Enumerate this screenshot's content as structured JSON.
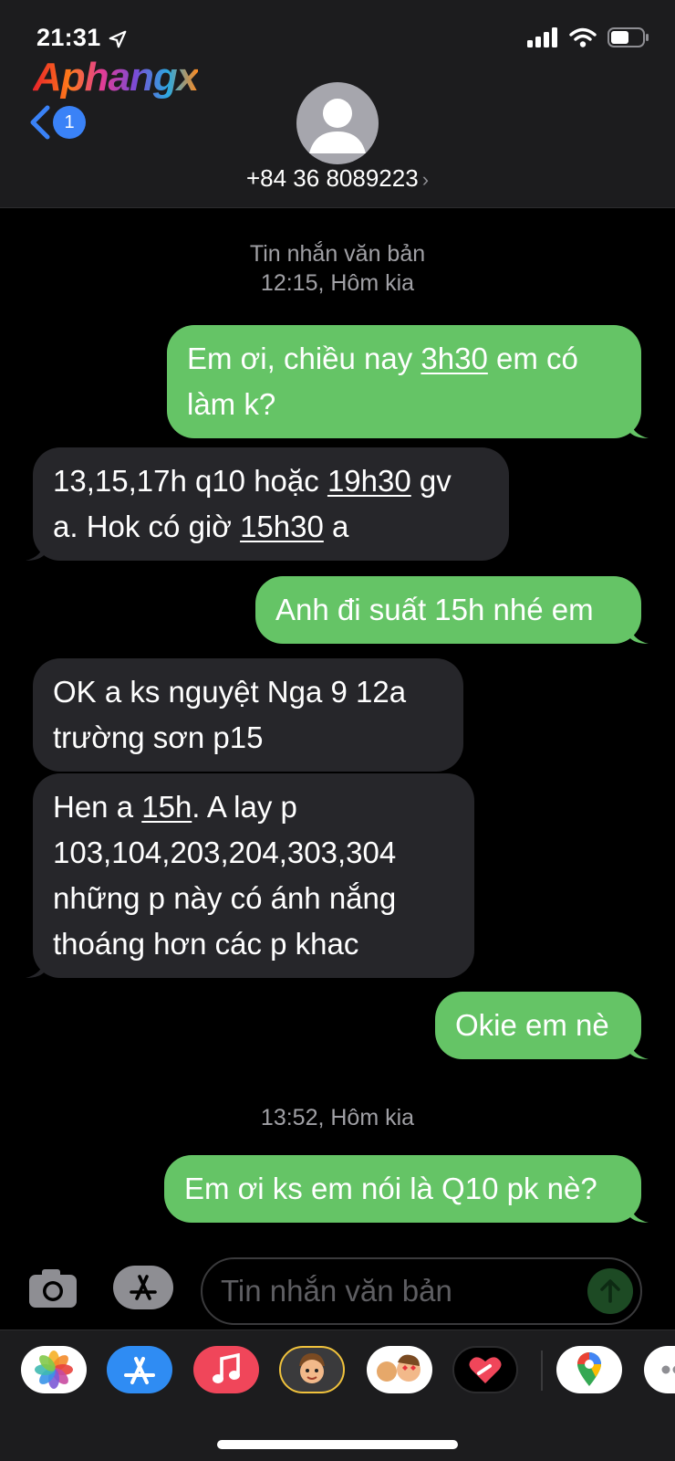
{
  "status_bar": {
    "time": "21:31"
  },
  "watermark": "Aphangx",
  "header": {
    "back_badge": "1",
    "contact": "+84 36 8089223",
    "contact_chevron": "›"
  },
  "conversation": {
    "timestamps": [
      {
        "label": "Tin nhắn văn bản",
        "time": "12:15, Hôm kia"
      },
      {
        "time": "13:52, Hôm kia"
      }
    ],
    "messages": [
      {
        "direction": "sent",
        "lines": [
          [
            "Em ơi, chiều nay ",
            "3h30",
            " em có"
          ],
          [
            "làm k?"
          ]
        ]
      },
      {
        "direction": "received",
        "lines": [
          [
            "13,15,17h q10 hoặc ",
            "19h30",
            " gv"
          ],
          [
            "a. Hok có giờ ",
            "15h30",
            " a"
          ]
        ]
      },
      {
        "direction": "sent",
        "lines": [
          [
            "Anh đi suất 15h nhé em"
          ]
        ]
      },
      {
        "direction": "received",
        "lines": [
          [
            "OK a ks nguyệt Nga 9 12a"
          ],
          [
            "trường sơn p15"
          ]
        ]
      },
      {
        "direction": "received",
        "lines": [
          [
            "Hen a ",
            "15h",
            ". A lay p"
          ],
          [
            "103,104,203,204,303,304"
          ],
          [
            "những p này có ánh nắng"
          ],
          [
            "thoáng hơn các p khac"
          ]
        ]
      },
      {
        "direction": "sent",
        "lines": [
          [
            "Okie em nè"
          ]
        ]
      },
      {
        "direction": "sent",
        "lines": [
          [
            "Em ơi ks em nói là Q10 pk nè?"
          ]
        ]
      }
    ]
  },
  "input": {
    "placeholder": "Tin nhắn văn bản",
    "value": ""
  },
  "app_drawer": {
    "apps": [
      "photos-icon",
      "app-store-icon",
      "music-icon",
      "memoji-icon",
      "memoji-stickers-icon",
      "digital-touch-icon",
      "google-maps-icon",
      "more-icon"
    ]
  },
  "colors": {
    "sent_bubble": "#65c466",
    "received_bubble": "#26262a",
    "header_bg": "#1c1c1e",
    "accent_blue": "#3a82f7"
  }
}
